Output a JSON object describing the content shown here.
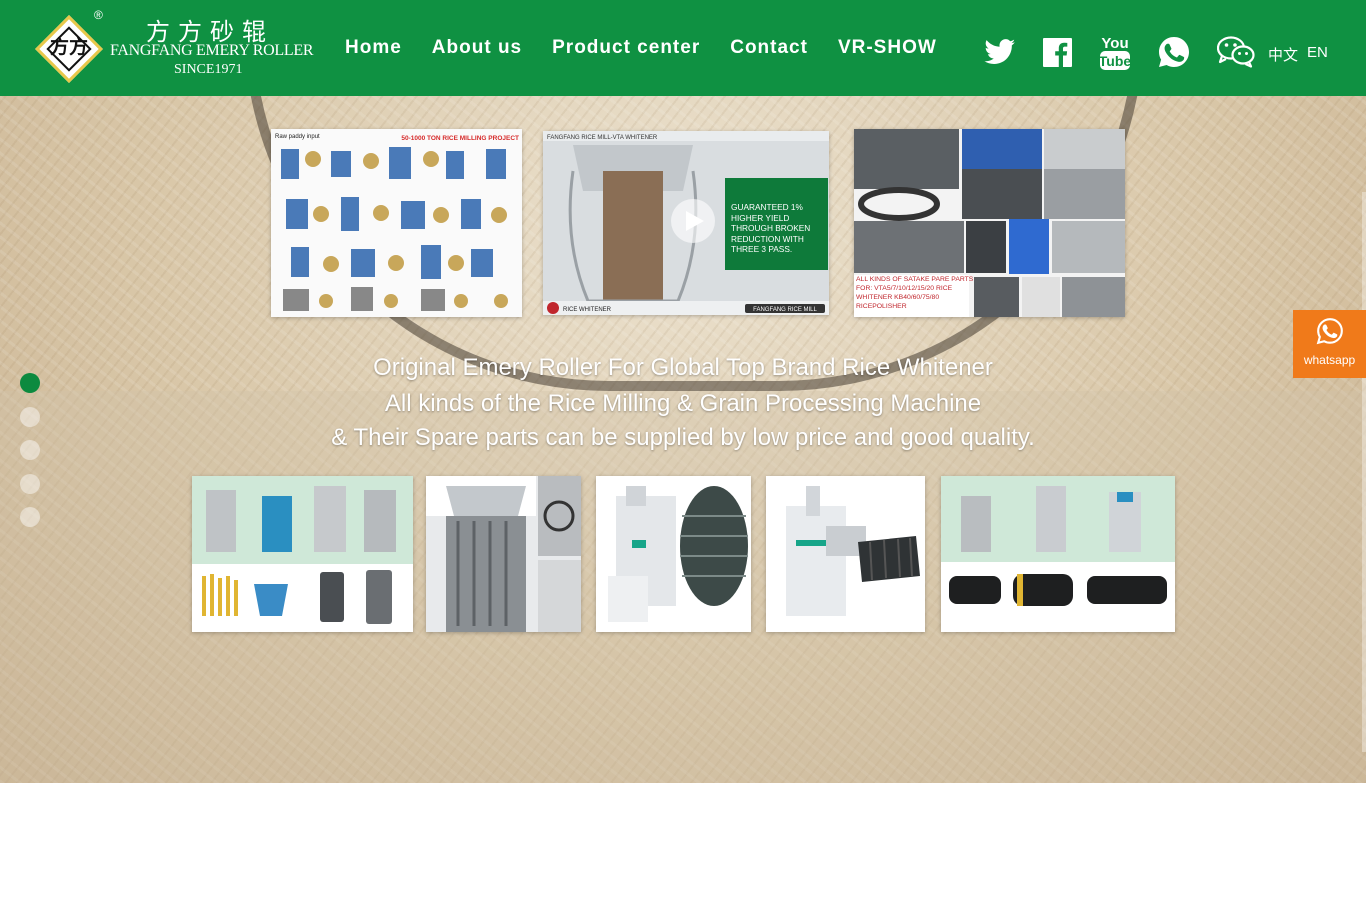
{
  "header": {
    "logo": {
      "mark": "方方",
      "registered": "®",
      "chinese_name": "方方砂辊",
      "english_name": "FANGFANG EMERY ROLLER",
      "since": "SINCE1971"
    },
    "nav": [
      "Home",
      "About us",
      "Product center",
      "Contact",
      "VR-SHOW"
    ],
    "social_icons": [
      "twitter-icon",
      "facebook-icon",
      "youtube-icon",
      "whatsapp-icon",
      "wechat-icon"
    ],
    "youtube_text": {
      "top": "You",
      "bottom": "Tube"
    },
    "languages": [
      "中文",
      "EN"
    ]
  },
  "banner": {
    "caption": {
      "line1": "Original Emery Roller For Global Top Brand Rice Whitener",
      "line2": "All kinds of the Rice Milling & Grain Processing Machine",
      "line3": "& Their Spare parts can be supplied by low price and good quality."
    },
    "top_thumbs": {
      "t1": {
        "title": "50-1000 TON RICE MILLING PROJECT",
        "label": "Raw paddy input"
      },
      "t2": {
        "title": "FANGFANG RICE MILL-VTA WHITENER",
        "headline": "GUARANTEED 1% HIGHER YIELD THROUGH BROKEN REDUCTION WITH THREE 3 PASS.",
        "footer_left": "RICE WHITENER",
        "footer_right": "FANGFANG RICE MILL"
      },
      "t3": {
        "caption": "ALL KINDS OF SATAKE PARE PARTS FOR: VTA5/7/10/12/15/20 RICE WHITENER KB40/60/75/80 RICEPOLISHER"
      }
    },
    "bottom_thumbs": [
      "product-thumb-whitener-set",
      "product-thumb-screen-cylinder",
      "product-thumb-vertical-whitener",
      "product-thumb-horizontal-polisher",
      "product-thumb-machine-lineup"
    ],
    "slides": 5,
    "active_slide": 1
  },
  "float_contact": {
    "label": "whatsapp"
  },
  "colors": {
    "header_green": "#0f9142",
    "active_dot": "#0c8a3f",
    "whatsapp_orange": "#f07a1a",
    "logo_gold": "#e8c84a",
    "t2_headline_green": "#0e7a3a",
    "t3_caption_red": "#c0262d"
  }
}
